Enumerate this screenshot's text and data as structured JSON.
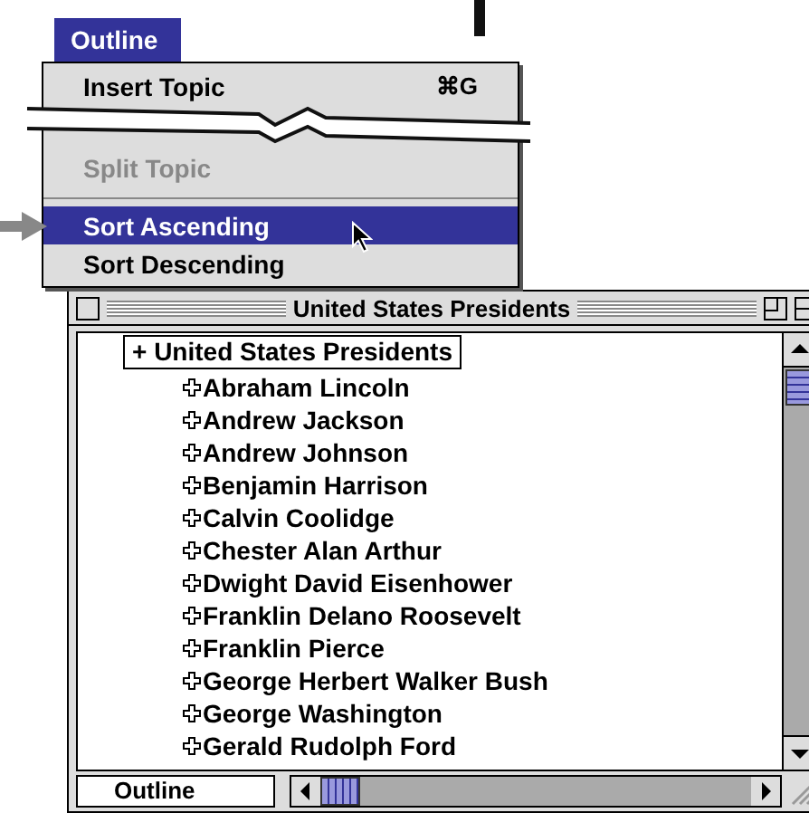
{
  "menu": {
    "title": "Outline",
    "items": [
      {
        "label": "Insert Topic",
        "shortcut": "⌘G",
        "disabled": false,
        "selected": false,
        "kind": "item"
      },
      {
        "label": "Split Topic",
        "disabled": true,
        "selected": false,
        "kind": "item"
      },
      {
        "kind": "separator"
      },
      {
        "label": "Sort Ascending",
        "disabled": false,
        "selected": true,
        "kind": "item"
      },
      {
        "label": "Sort Descending",
        "disabled": false,
        "selected": false,
        "kind": "item"
      }
    ]
  },
  "window": {
    "title": "United States Presidents"
  },
  "outline": {
    "root": {
      "marker": "+",
      "label": "United States Presidents",
      "selected": true,
      "children": [
        {
          "label": "Abraham Lincoln"
        },
        {
          "label": "Andrew Jackson"
        },
        {
          "label": "Andrew Johnson"
        },
        {
          "label": "Benjamin Harrison"
        },
        {
          "label": "Calvin Coolidge"
        },
        {
          "label": "Chester Alan Arthur"
        },
        {
          "label": "Dwight David Eisenhower"
        },
        {
          "label": "Franklin Delano Roosevelt"
        },
        {
          "label": "Franklin Pierce"
        },
        {
          "label": "George Herbert Walker Bush"
        },
        {
          "label": "George Washington"
        },
        {
          "label": "Gerald Rudolph Ford"
        }
      ]
    }
  },
  "status_bar": {
    "view": "Outline"
  }
}
